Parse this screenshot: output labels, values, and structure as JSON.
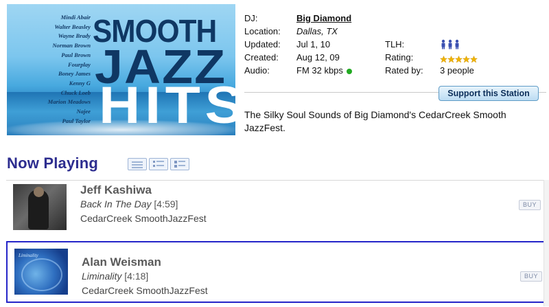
{
  "station_art": {
    "title_line1": "SMOOTH",
    "title_line2": "JAZZ",
    "title_line3": "HITS",
    "artists": [
      "Mindi Abair",
      "Walter Beasley",
      "Wayne Brady",
      "Norman Brown",
      "Paul Brown",
      "Fourplay",
      "Boney James",
      "Kenny G",
      "Chuck Loeb",
      "Marion Meadows",
      "Najee",
      "Paul Taylor"
    ]
  },
  "info": {
    "dj_label": "DJ:",
    "dj_value": "Big Diamond",
    "location_label": "Location:",
    "location_value": "Dallas, TX",
    "updated_label": "Updated:",
    "updated_value": "Jul 1, 10",
    "created_label": "Created:",
    "created_value": "Aug 12, 09",
    "audio_label": "Audio:",
    "audio_value": "FM 32 kbps",
    "tlh_label": "TLH:",
    "rating_label": "Rating:",
    "rating_stars": 5,
    "rated_by_label": "Rated by:",
    "rated_by_value": "3 people",
    "support_button": "Support this Station",
    "description": "The Silky Soul Sounds of Big Diamond's CedarCreek Smooth JazzFest."
  },
  "now_playing": {
    "heading": "Now Playing",
    "tracks": [
      {
        "artist": "Jeff Kashiwa",
        "title": "Back In The Day",
        "duration": "[4:59]",
        "album": "CedarCreek SmoothJazzFest",
        "buy": "BUY"
      },
      {
        "artist": "Alan Weisman",
        "title": "Liminality",
        "duration": "[4:18]",
        "album": "CedarCreek SmoothJazzFest",
        "buy": "BUY",
        "thumb_caption": "Liminality"
      }
    ]
  },
  "colors": {
    "heading": "#2d2d8f",
    "selection_border": "#2424c8",
    "status_green": "#22aa22",
    "star": "#f0b400"
  },
  "icons": {
    "tlh": "people-icon",
    "audio_status": "green-dot-icon",
    "views": [
      "list-compact-icon",
      "list-icon",
      "list-detail-icon"
    ]
  }
}
